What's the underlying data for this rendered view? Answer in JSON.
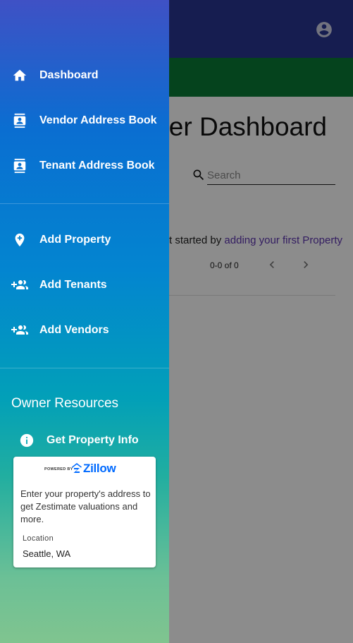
{
  "page": {
    "title": "Owner Dashboard",
    "search": {
      "placeholder": "Search",
      "value": ""
    },
    "empty_state": {
      "prefix": "Get started by ",
      "link": "adding your first Property"
    },
    "pagination": {
      "range": "0-0 of 0"
    }
  },
  "drawer": {
    "nav_items": [
      {
        "label": "Dashboard",
        "icon": "home-icon"
      },
      {
        "label": "Vendor Address Book",
        "icon": "contact-book-icon"
      },
      {
        "label": "Tenant Address Book",
        "icon": "contact-book-icon"
      }
    ],
    "action_items": [
      {
        "label": "Add Property",
        "icon": "add-location-icon"
      },
      {
        "label": "Add Tenants",
        "icon": "group-add-icon"
      },
      {
        "label": "Add Vendors",
        "icon": "group-add-icon"
      }
    ],
    "resources": {
      "title": "Owner Resources",
      "get_info_label": "Get Property Info",
      "get_info_icon": "info-icon",
      "zillow_card": {
        "powered_by": "POWERED BY",
        "brand": "Zillow",
        "description": "Enter your property's address to get Zestimate valuations and more.",
        "location_label": "Location",
        "location_value": "Seattle, WA"
      }
    }
  },
  "colors": {
    "topbar": "#283593",
    "greenbar": "#0a7a35",
    "link": "#5e35b1",
    "zillow_blue": "#006aff"
  }
}
